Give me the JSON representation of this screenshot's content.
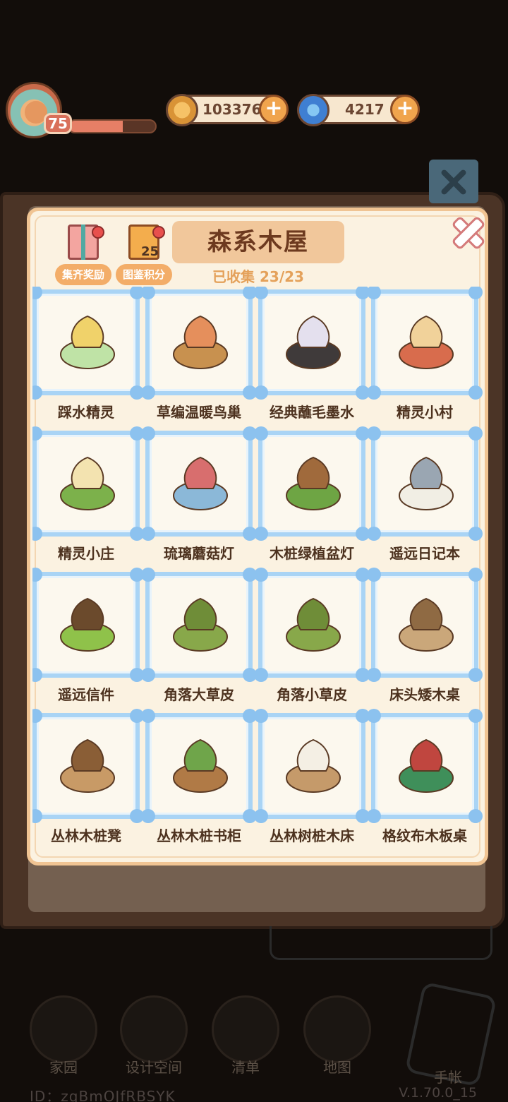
{
  "hud": {
    "level": "75",
    "xp_progress": 0.62,
    "coins": "103376",
    "gems": "4217",
    "add_label": "+"
  },
  "modal": {
    "title": "森系木屋",
    "collected": "已收集 23/23",
    "reward_button": "集齐奖励",
    "points_button": "图鉴积分",
    "points_count": "25"
  },
  "items": [
    {
      "name": "踩水精灵",
      "icon": "fairy-icon"
    },
    {
      "name": "草编温暖鸟巢",
      "icon": "bird-nest-icon"
    },
    {
      "name": "经典蘸毛墨水",
      "icon": "quill-ink-icon"
    },
    {
      "name": "精灵小村",
      "icon": "village-icon"
    },
    {
      "name": "精灵小庄",
      "icon": "cottage-icon"
    },
    {
      "name": "琉璃蘑菇灯",
      "icon": "mushroom-lamp-icon"
    },
    {
      "name": "木桩绿植盆灯",
      "icon": "plant-lamp-icon"
    },
    {
      "name": "遥远日记本",
      "icon": "diary-icon"
    },
    {
      "name": "遥远信件",
      "icon": "letters-icon"
    },
    {
      "name": "角落大草皮",
      "icon": "big-turf-icon"
    },
    {
      "name": "角落小草皮",
      "icon": "small-turf-icon"
    },
    {
      "name": "床头矮木桌",
      "icon": "low-table-icon"
    },
    {
      "name": "丛林木桩凳",
      "icon": "stump-stool-icon"
    },
    {
      "name": "丛林木桩书柜",
      "icon": "stump-shelf-icon"
    },
    {
      "name": "丛林树桩木床",
      "icon": "stump-bed-icon"
    },
    {
      "name": "格纹布木板桌",
      "icon": "plaid-table-icon"
    }
  ],
  "background": {
    "nav": [
      "家园",
      "设计空间",
      "清单",
      "地图",
      "手帐"
    ],
    "id_text": "ID：zqBmOJfRBSYK",
    "version": "V.1.70.0_15"
  },
  "colors": {
    "accent": "#f3ad68",
    "frame": "#a9d4f5",
    "title_plate": "#f1c79b"
  }
}
